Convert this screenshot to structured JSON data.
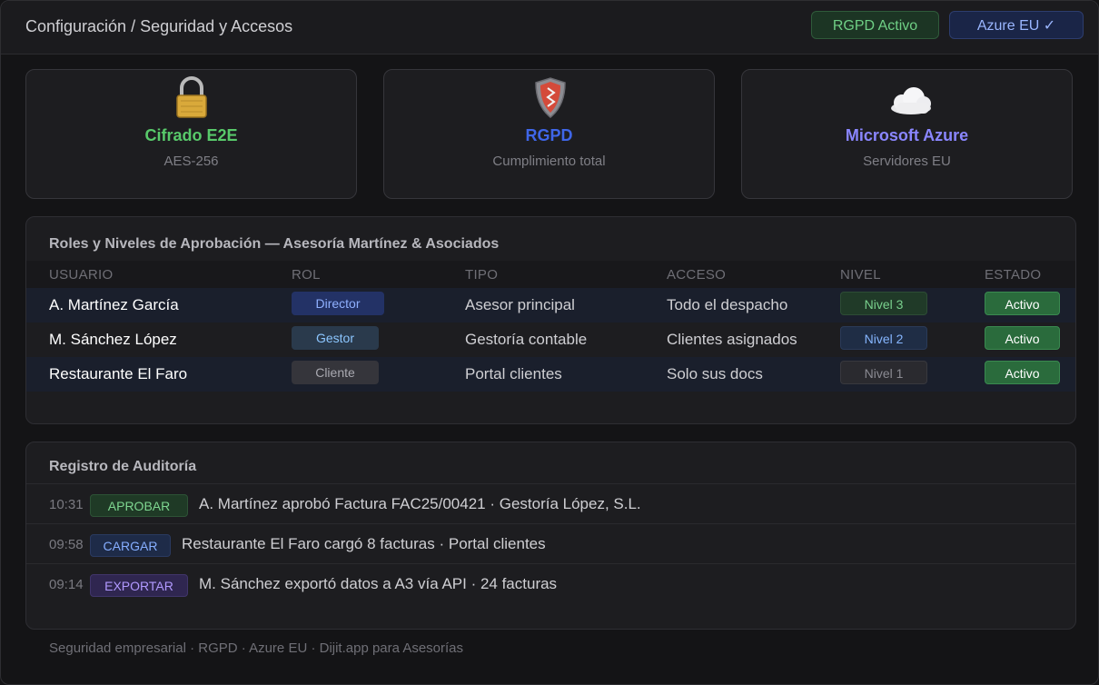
{
  "header": {
    "breadcrumb": "Configuración / Seguridad y Accesos",
    "pills": {
      "rgpd": "RGPD Activo",
      "azure": "Azure EU ✓"
    }
  },
  "cards": [
    {
      "icon": "lock-icon",
      "title": "Cifrado E2E",
      "subtitle": "AES-256",
      "color": "#58c96a"
    },
    {
      "icon": "shield-icon",
      "title": "RGPD",
      "subtitle": "Cumplimiento total",
      "color": "#3f66e8"
    },
    {
      "icon": "cloud-icon",
      "title": "Microsoft Azure",
      "subtitle": "Servidores EU",
      "color": "#8a86ff"
    }
  ],
  "roles": {
    "title": "Roles y Niveles de Aprobación — Asesoría Martínez & Asociados",
    "columns": [
      "USUARIO",
      "ROL",
      "TIPO",
      "ACCESO",
      "NIVEL",
      "ESTADO"
    ],
    "rows": [
      {
        "user": "A. Martínez García",
        "role": "Director",
        "type": "Asesor principal",
        "access": "Todo el despacho",
        "level": "Nivel 3",
        "status": "Activo"
      },
      {
        "user": "M. Sánchez López",
        "role": "Gestor",
        "type": "Gestoría contable",
        "access": "Clientes asignados",
        "level": "Nivel 2",
        "status": "Activo"
      },
      {
        "user": "Restaurante El Faro",
        "role": "Cliente",
        "type": "Portal clientes",
        "access": "Solo sus docs",
        "level": "Nivel 1",
        "status": "Activo"
      }
    ]
  },
  "audit": {
    "title": "Registro de Auditoría",
    "entries": [
      {
        "time": "10:31",
        "tag": "APROBAR",
        "text": "A. Martínez aprobó Factura FAC25/00421 · Gestoría López, S.L."
      },
      {
        "time": "09:58",
        "tag": "CARGAR",
        "text": "Restaurante El Faro cargó 8 facturas · Portal clientes"
      },
      {
        "time": "09:14",
        "tag": "EXPORTAR",
        "text": "M. Sánchez exportó datos a A3 vía API · 24 facturas"
      }
    ]
  },
  "footer": "Seguridad empresarial · RGPD · Azure EU · Dijit.app para Asesorías"
}
